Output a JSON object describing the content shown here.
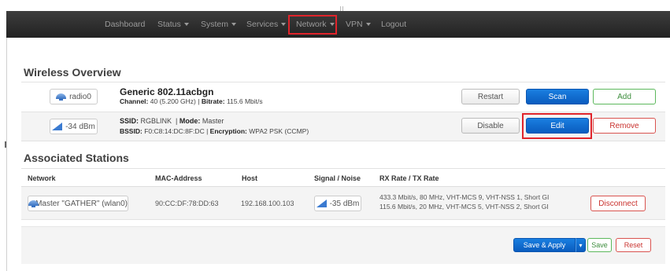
{
  "nav": {
    "items": [
      {
        "label": "Dashboard",
        "caret": false
      },
      {
        "label": "Status",
        "caret": true
      },
      {
        "label": "System",
        "caret": true
      },
      {
        "label": "Services",
        "caret": true
      },
      {
        "label": "Network",
        "caret": true
      },
      {
        "label": "VPN",
        "caret": true
      },
      {
        "label": "Logout",
        "caret": false
      }
    ],
    "active": "Network"
  },
  "wireless_overview": {
    "heading": "Wireless Overview",
    "device": {
      "badge": "radio0",
      "name": "Generic 802.11acbgn",
      "channel_label": "Channel:",
      "channel_value": "40 (5.200 GHz)",
      "bitrate_label": "Bitrate:",
      "bitrate_value": "115.6 Mbit/s",
      "buttons": {
        "restart": "Restart",
        "scan": "Scan",
        "add": "Add"
      }
    },
    "network": {
      "badge": "-34 dBm",
      "ssid_label": "SSID:",
      "ssid_value": "RGBLINK",
      "mode_label": "Mode:",
      "mode_value": "Master",
      "bssid_label": "BSSID:",
      "bssid_value": "F0:C8:14:DC:8F:DC",
      "encryption_label": "Encryption:",
      "encryption_value": "WPA2 PSK (CCMP)",
      "buttons": {
        "disable": "Disable",
        "edit": "Edit",
        "remove": "Remove"
      }
    }
  },
  "associated_stations": {
    "heading": "Associated Stations",
    "columns": [
      "Network",
      "MAC-Address",
      "Host",
      "Signal / Noise",
      "RX Rate / TX Rate"
    ],
    "rows": [
      {
        "network": "Master \"GATHER\" (wlan0)",
        "mac": "90:CC:DF:78:DD:63",
        "host": "192.168.100.103",
        "signal": "-35 dBm",
        "rx_rate": "433.3 Mbit/s, 80 MHz, VHT-MCS 9, VHT-NSS 1, Short GI",
        "tx_rate": "115.6 Mbit/s, 20 MHz, VHT-MCS 5, VHT-NSS 2, Short GI",
        "action": "Disconnect"
      }
    ]
  },
  "footer": {
    "save_apply": "Save & Apply",
    "save": "Save",
    "reset": "Reset"
  },
  "colors": {
    "accent": "#0a5cbf",
    "highlight": "#e0242b",
    "success": "#5cb85c",
    "danger": "#d9534f"
  }
}
